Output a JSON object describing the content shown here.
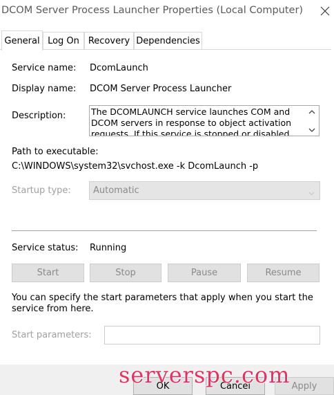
{
  "window": {
    "title": "DCOM Server Process Launcher Properties (Local Computer)"
  },
  "tabs": [
    {
      "label": "General",
      "active": true
    },
    {
      "label": "Log On",
      "active": false
    },
    {
      "label": "Recovery",
      "active": false
    },
    {
      "label": "Dependencies",
      "active": false
    }
  ],
  "general": {
    "service_name_label": "Service name:",
    "service_name_value": "DcomLaunch",
    "display_name_label": "Display name:",
    "display_name_value": "DCOM Server Process Launcher",
    "description_label": "Description:",
    "description_value": "The DCOMLAUNCH service launches COM and DCOM servers in response to object activation requests. If this service is stopped or disabled",
    "path_label": "Path to executable:",
    "path_value": "C:\\WINDOWS\\system32\\svchost.exe -k DcomLaunch -p",
    "startup_type_label": "Startup type:",
    "startup_type_value": "Automatic",
    "service_status_label": "Service status:",
    "service_status_value": "Running",
    "buttons": {
      "start": "Start",
      "stop": "Stop",
      "pause": "Pause",
      "resume": "Resume"
    },
    "start_params_note": "You can specify the start parameters that apply when you start the service from here.",
    "start_params_label": "Start parameters:",
    "start_params_value": ""
  },
  "footer": {
    "ok": "OK",
    "cancel": "Cancel",
    "apply": "Apply"
  },
  "watermark": "serverspc.com",
  "colors": {
    "disabled_text": "#8a8a8a",
    "tab_border": "#d9d9d9",
    "footer_bg": "#f0f0f0",
    "watermark": "#e8265a"
  },
  "icons": {
    "close": "close-icon",
    "scroll_up": "chevron-up-icon",
    "scroll_down": "chevron-down-icon",
    "select_dropdown": "chevron-down-icon"
  }
}
